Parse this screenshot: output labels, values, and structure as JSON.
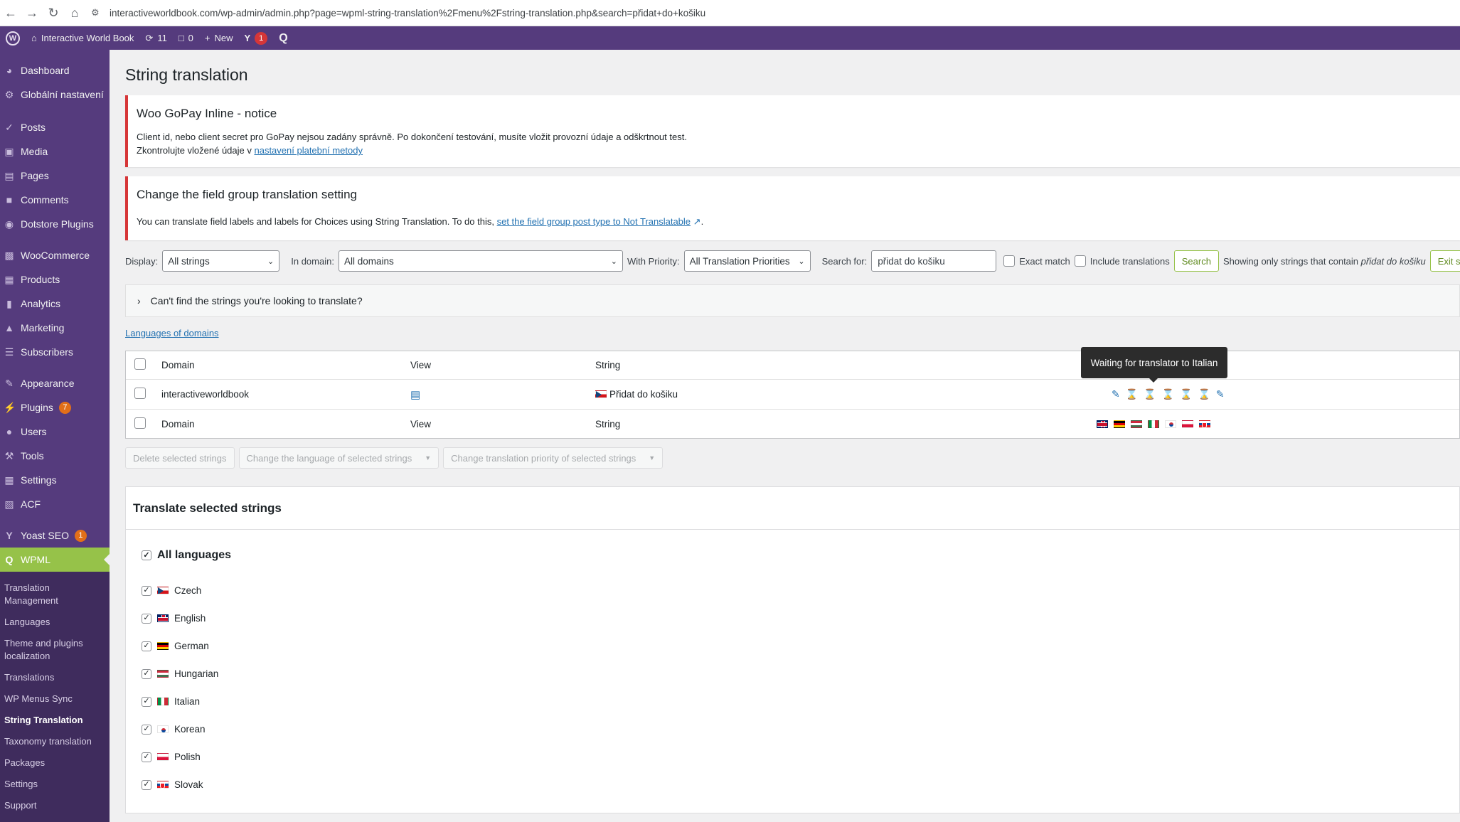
{
  "browser": {
    "url": "interactiveworldbook.com/wp-admin/admin.php?page=wpml-string-translation%2Fmenu%2Fstring-translation.php&search=přidat+do+košiku"
  },
  "adminbar": {
    "site_name": "Interactive World Book",
    "updates_count": "11",
    "comments_count": "0",
    "new_label": "New",
    "yoast_count": "1"
  },
  "sidebar": {
    "items": [
      {
        "label": "Dashboard",
        "icon": "dashboard-icon"
      },
      {
        "label": "Globální nastavení",
        "icon": "gear-icon"
      },
      {
        "label": "Posts",
        "icon": "pin-icon"
      },
      {
        "label": "Media",
        "icon": "media-icon"
      },
      {
        "label": "Pages",
        "icon": "pages-icon"
      },
      {
        "label": "Comments",
        "icon": "comment-icon"
      },
      {
        "label": "Dotstore Plugins",
        "icon": "circle-icon"
      },
      {
        "label": "WooCommerce",
        "icon": "woo-icon"
      },
      {
        "label": "Products",
        "icon": "box-icon"
      },
      {
        "label": "Analytics",
        "icon": "bars-icon"
      },
      {
        "label": "Marketing",
        "icon": "megaphone-icon"
      },
      {
        "label": "Subscribers",
        "icon": "list-icon"
      },
      {
        "label": "Appearance",
        "icon": "brush-icon"
      },
      {
        "label": "Plugins",
        "icon": "plug-icon",
        "badge": "7"
      },
      {
        "label": "Users",
        "icon": "user-icon"
      },
      {
        "label": "Tools",
        "icon": "wrench-icon"
      },
      {
        "label": "Settings",
        "icon": "settings-icon"
      },
      {
        "label": "ACF",
        "icon": "grid-icon"
      },
      {
        "label": "Yoast SEO",
        "icon": "yoast-icon",
        "badge": "1"
      },
      {
        "label": "WPML",
        "icon": "wpml-icon"
      }
    ],
    "submenu": [
      "Translation Management",
      "Languages",
      "Theme and plugins localization",
      "Translations",
      "WP Menus Sync",
      "String Translation",
      "Taxonomy translation",
      "Packages",
      "Settings",
      "Support"
    ]
  },
  "page": {
    "title": "String translation"
  },
  "notice1": {
    "title": "Woo GoPay Inline - notice",
    "line1": "Client id, nebo client secret pro GoPay nejsou zadány správně. Po dokončení testování, musíte vložit provozní údaje a odškrtnout test.",
    "line2_prefix": "Zkontrolujte vložené údaje v ",
    "line2_link": "nastavení platební metody"
  },
  "notice2": {
    "title": "Change the field group translation setting",
    "text_prefix": "You can translate field labels and labels for Choices using String Translation. To do this, ",
    "link": "set the field group post type to Not Translatable",
    "text_suffix": "."
  },
  "filters": {
    "display_label": "Display:",
    "display_value": "All strings",
    "domain_label": "In domain:",
    "domain_value": "All domains",
    "priority_label": "With Priority:",
    "priority_value": "All Translation Priorities",
    "search_label": "Search for:",
    "search_value": "přidat do košiku",
    "exact_label": "Exact match",
    "include_label": "Include translations",
    "search_button": "Search",
    "showing_prefix": "Showing only strings that contain ",
    "showing_term": "přidat do košiku",
    "exit_button": "Exit search"
  },
  "collapse": {
    "label": "Can't find the strings you're looking to translate?"
  },
  "languages_link": "Languages of domains",
  "table": {
    "headers": {
      "domain": "Domain",
      "view": "View",
      "string": "String"
    },
    "row": {
      "domain": "interactiveworldbook",
      "string": "Přidat do košiku"
    }
  },
  "tooltip": "Waiting for translator to Italian",
  "bulk": {
    "delete": "Delete selected strings",
    "change_language": "Change the language of selected strings",
    "change_priority": "Change translation priority of selected strings"
  },
  "translate": {
    "title": "Translate selected strings",
    "all_languages": "All languages",
    "languages": [
      {
        "name": "Czech",
        "flag": "cz"
      },
      {
        "name": "English",
        "flag": "en"
      },
      {
        "name": "German",
        "flag": "de"
      },
      {
        "name": "Hungarian",
        "flag": "hu"
      },
      {
        "name": "Italian",
        "flag": "it"
      },
      {
        "name": "Korean",
        "flag": "ko"
      },
      {
        "name": "Polish",
        "flag": "pl"
      },
      {
        "name": "Slovak",
        "flag": "sk"
      }
    ]
  },
  "colors": {
    "sidebar": "#553b7d",
    "active_menu": "#96c249",
    "notice_border": "#d63638",
    "link": "#2271b1"
  }
}
